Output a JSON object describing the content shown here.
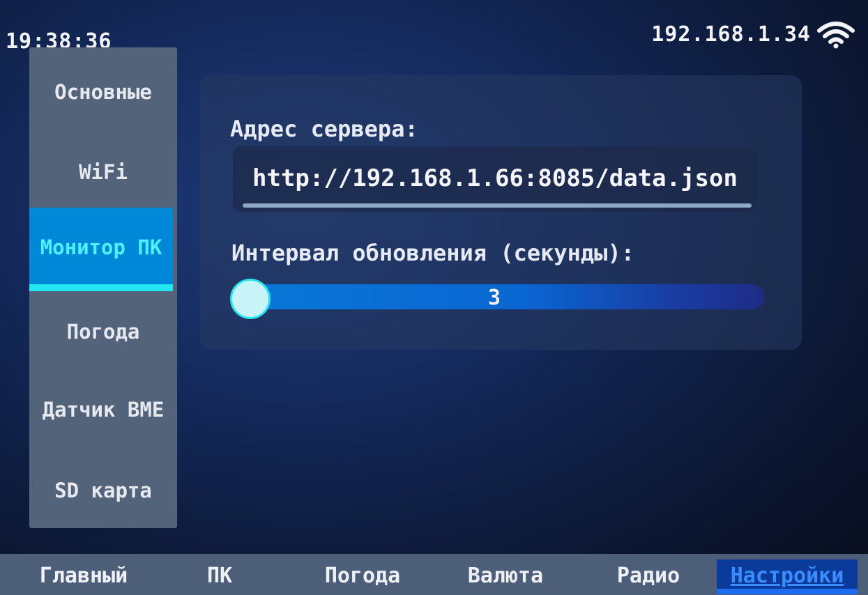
{
  "status": {
    "time": "19:38:36",
    "ip": "192.168.1.34",
    "wifi_icon": "wifi-icon"
  },
  "sidebar": {
    "items": [
      {
        "label": "Основные",
        "active": false
      },
      {
        "label": "WiFi",
        "active": false
      },
      {
        "label": "Монитор ПК",
        "active": true
      },
      {
        "label": "Погода",
        "active": false
      },
      {
        "label": "Датчик BME",
        "active": false
      },
      {
        "label": "SD карта",
        "active": false
      }
    ]
  },
  "settings": {
    "server_label": "Адрес сервера:",
    "server_value": "http://192.168.1.66:8085/data.json",
    "interval_label": "Интервал обновления (секунды):",
    "interval_value": "3"
  },
  "tabs": [
    {
      "label": "Главный",
      "active": false
    },
    {
      "label": "ПК",
      "active": false
    },
    {
      "label": "Погода",
      "active": false
    },
    {
      "label": "Валюта",
      "active": false
    },
    {
      "label": "Радио",
      "active": false
    },
    {
      "label": "Настройки",
      "active": true
    }
  ],
  "colors": {
    "accent": "#0088d8",
    "highlight": "#22e6f0",
    "active_tab_text": "#3a8cff"
  }
}
